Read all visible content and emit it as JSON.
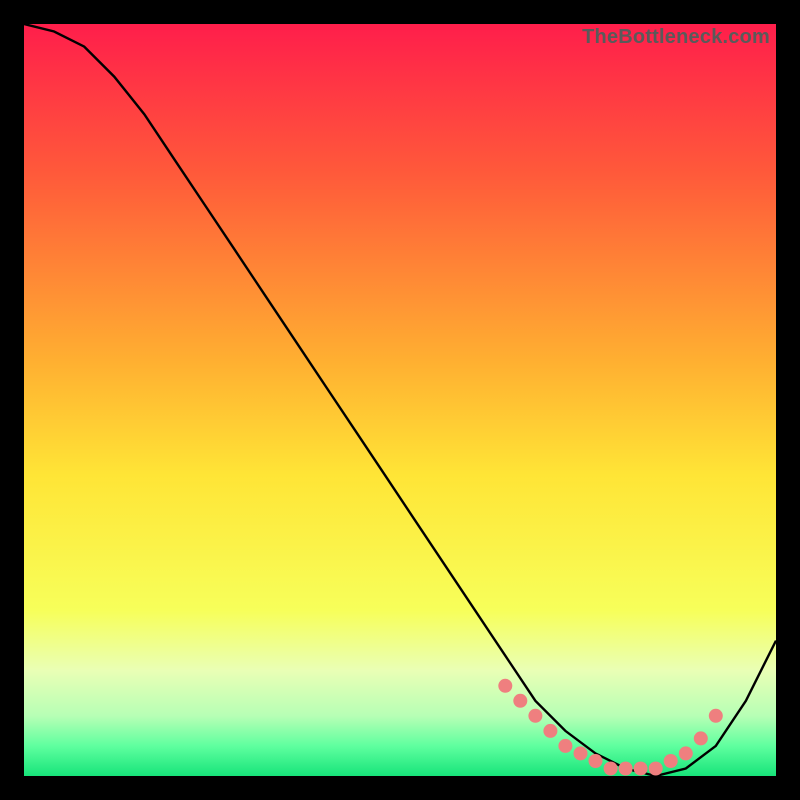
{
  "watermark": "TheBottleneck.com",
  "chart_data": {
    "type": "line",
    "title": "",
    "xlabel": "",
    "ylabel": "",
    "xlim": [
      0,
      100
    ],
    "ylim": [
      0,
      100
    ],
    "background_gradient_stops": [
      {
        "offset": 0.0,
        "color": "#ff1e4b"
      },
      {
        "offset": 0.2,
        "color": "#ff5a3a"
      },
      {
        "offset": 0.45,
        "color": "#ffb031"
      },
      {
        "offset": 0.6,
        "color": "#ffe536"
      },
      {
        "offset": 0.78,
        "color": "#f7ff5a"
      },
      {
        "offset": 0.86,
        "color": "#e9ffb5"
      },
      {
        "offset": 0.92,
        "color": "#b7ffb5"
      },
      {
        "offset": 0.96,
        "color": "#5fff9f"
      },
      {
        "offset": 1.0,
        "color": "#17e47a"
      }
    ],
    "series": [
      {
        "name": "curve",
        "color": "#000000",
        "x": [
          0,
          4,
          8,
          12,
          16,
          20,
          24,
          28,
          32,
          36,
          40,
          44,
          48,
          52,
          56,
          60,
          64,
          68,
          72,
          76,
          80,
          84,
          88,
          92,
          96,
          100
        ],
        "y": [
          100,
          99,
          97,
          93,
          88,
          82,
          76,
          70,
          64,
          58,
          52,
          46,
          40,
          34,
          28,
          22,
          16,
          10,
          6,
          3,
          1,
          0,
          1,
          4,
          10,
          18
        ]
      },
      {
        "name": "markers",
        "color": "#ef7f7f",
        "x": [
          64,
          66,
          68,
          70,
          72,
          74,
          76,
          78,
          80,
          82,
          84,
          86,
          88,
          90,
          92
        ],
        "y": [
          12,
          10,
          8,
          6,
          4,
          3,
          2,
          1,
          1,
          1,
          1,
          2,
          3,
          5,
          8
        ]
      }
    ]
  }
}
